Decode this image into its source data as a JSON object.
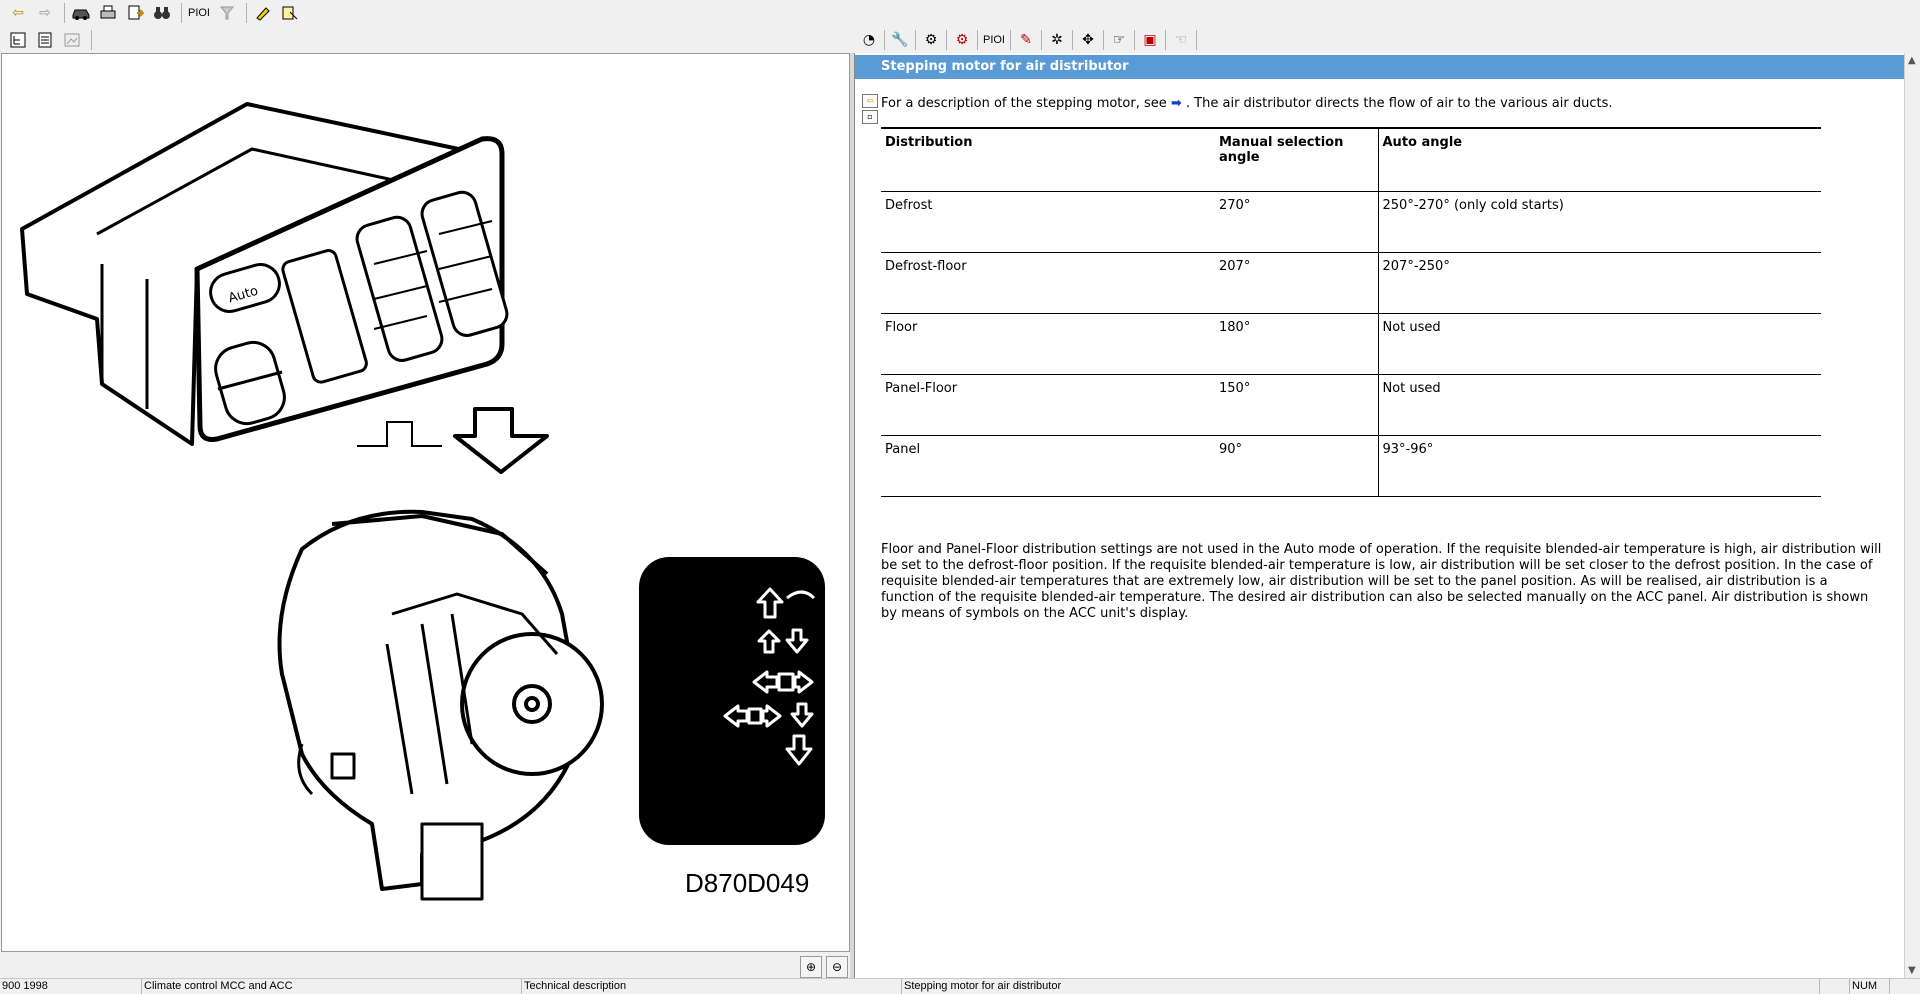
{
  "toolbar": {
    "items": [
      {
        "name": "back-arrow-icon",
        "glyph": "⇦"
      },
      {
        "name": "forward-arrow-icon",
        "glyph": "⇨"
      },
      {
        "name": "car-icon",
        "glyph": "🚗"
      },
      {
        "name": "print-icon",
        "glyph": "🖶"
      },
      {
        "name": "document-export-icon",
        "glyph": "📄"
      },
      {
        "name": "binoculars-icon",
        "glyph": "👓"
      }
    ],
    "pioi_label": "PIOI"
  },
  "right_toolbar": {
    "pioi_label": "PIOI"
  },
  "figure": {
    "caption": "D870D049"
  },
  "content": {
    "title": "Stepping motor for air distributor",
    "intro_before": "For a description of the stepping motor, see ",
    "intro_arrow": "➡",
    "intro_after": " . The air distributor directs the flow of air to the various air ducts.",
    "table": {
      "headers": [
        "Distribution",
        "Manual selection angle",
        "Auto angle"
      ],
      "rows": [
        [
          "Defrost",
          "270°",
          "250°-270° (only cold starts)"
        ],
        [
          "Defrost-floor",
          "207°",
          "207°-250°"
        ],
        [
          "Floor",
          "180°",
          "Not used"
        ],
        [
          "Panel-Floor",
          "150°",
          "Not used"
        ],
        [
          "Panel",
          "90°",
          "93°-96°"
        ]
      ]
    },
    "paragraph": "Floor and Panel-Floor distribution settings are not used in the Auto mode of operation. If the requisite blended-air temperature is high, air distribution will be set to the defrost-floor position. If the requisite blended-air temperature is low, air distribution will be set closer to the defrost position. In the case of requisite blended-air temperatures that are extremely low, air distribution will be set to the panel position. As will be realised, air distribution is a function of the requisite blended-air temperature. The desired air distribution can also be selected manually on the ACC panel. Air distribution is shown by means of symbols on the ACC unit's display."
  },
  "statusbar": {
    "model": "900 1998",
    "section": "Climate control MCC and ACC",
    "doc_type": "Technical description",
    "topic": "Stepping motor for air distributor",
    "num": "NUM"
  },
  "colors": {
    "title_bar": "#5b9bd5",
    "link_arrow": "#1a3fbf"
  }
}
